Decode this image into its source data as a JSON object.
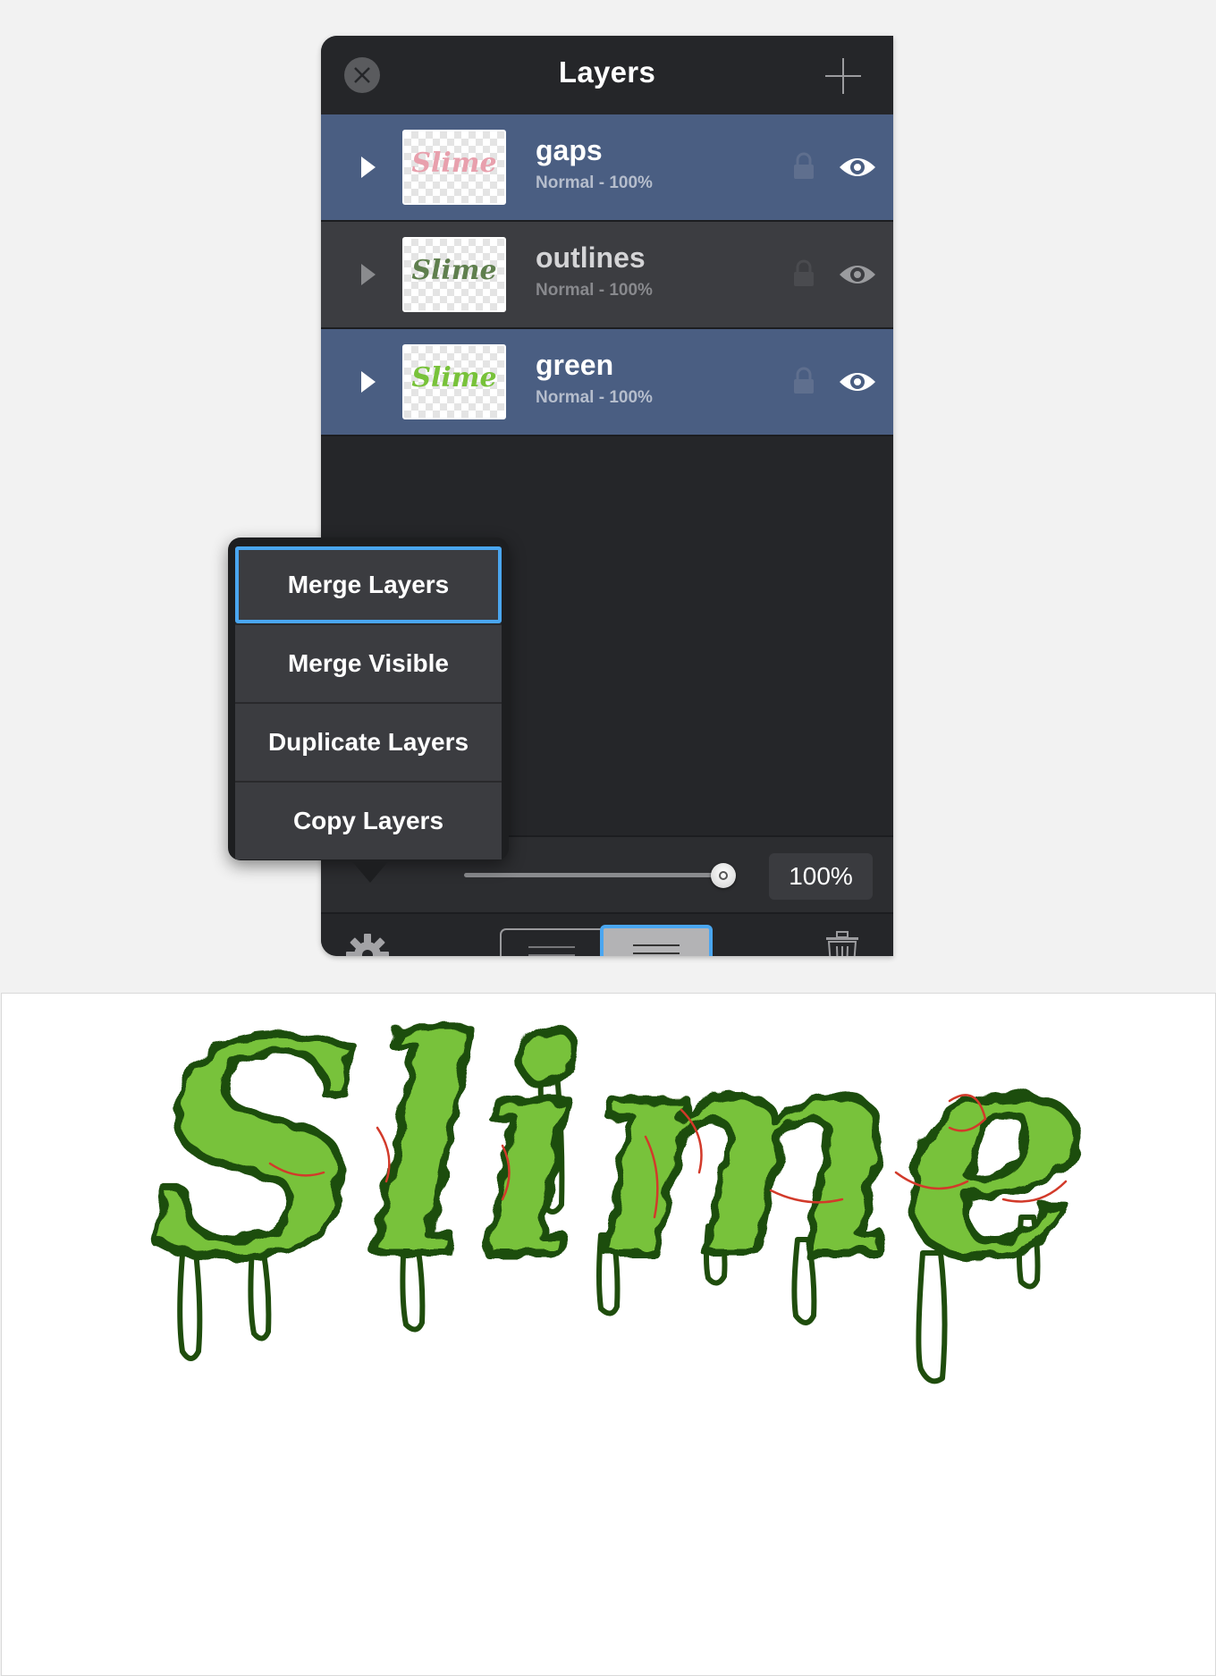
{
  "panel": {
    "title": "Layers",
    "close_icon": "close-circle-icon",
    "add_icon": "plus-icon"
  },
  "layers": [
    {
      "name": "gaps",
      "mode": "Normal - 100%",
      "selected": true,
      "thumb_text": "Slime",
      "thumb_color": "#e8a0ad"
    },
    {
      "name": "outlines",
      "mode": "Normal - 100%",
      "selected": false,
      "thumb_text": "Slime",
      "thumb_color": "#5f7f4e"
    },
    {
      "name": "green",
      "mode": "Normal - 100%",
      "selected": true,
      "thumb_text": "Slime",
      "thumb_color": "#78c23a"
    }
  ],
  "opacity": {
    "value_text": "100%",
    "fraction": 1.0
  },
  "menu": {
    "items": [
      "Merge Layers",
      "Merge Visible",
      "Duplicate Layers",
      "Copy Layers"
    ],
    "highlighted_index": 0
  },
  "toolbar": {
    "gear_icon": "gear-icon",
    "trash_icon": "trash-icon",
    "view_mode_selected": "list-right"
  },
  "colors": {
    "selected_row": "#4a5e82",
    "unselected_row": "#3c3d41",
    "accent": "#4aa6f0",
    "slime_fill": "#78c23a",
    "slime_outline": "#1f4d0d",
    "slime_gaps": "#d23a2a"
  },
  "canvas": {
    "artwork_text": "Slime"
  }
}
